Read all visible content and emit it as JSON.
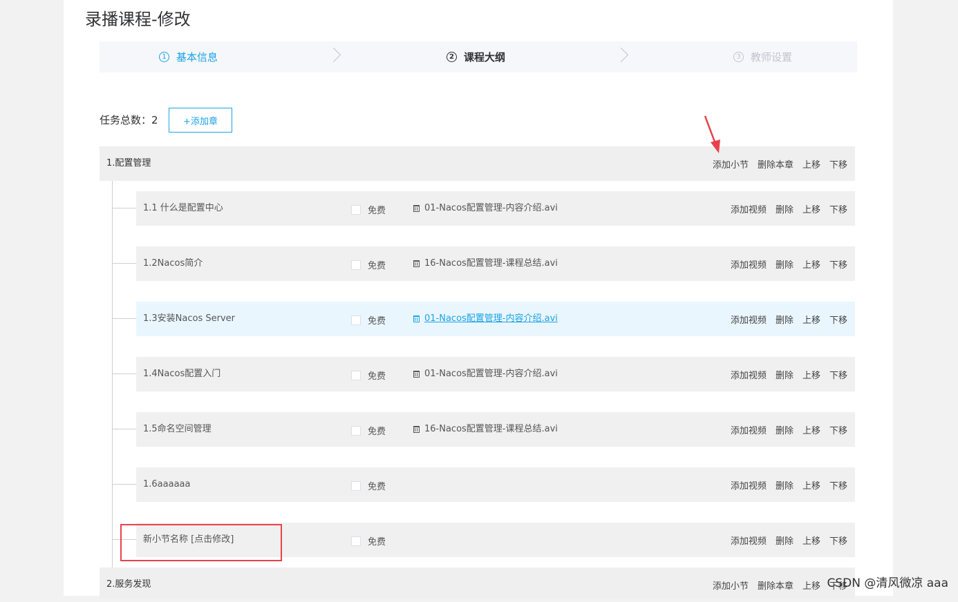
{
  "page": {
    "title": "录播课程-修改"
  },
  "steps": [
    {
      "num": "1",
      "label": "基本信息"
    },
    {
      "num": "2",
      "label": "课程大纲"
    },
    {
      "num": "3",
      "label": "教师设置"
    }
  ],
  "toolbar": {
    "task_total_label": "任务总数：2",
    "add_chapter": "+添加章"
  },
  "chapter_actions": {
    "add_section": "添加小节",
    "delete_chapter": "删除本章",
    "move_up": "上移",
    "move_down": "下移"
  },
  "lesson_actions": {
    "add_video": "添加视频",
    "delete": "删除",
    "move_up": "上移",
    "move_down": "下移"
  },
  "free_label": "免费",
  "chapters": [
    {
      "title": "1.配置管理",
      "lessons": [
        {
          "title": "1.1 什么是配置中心",
          "video": "01-Nacos配置管理-内容介绍.avi"
        },
        {
          "title": "1.2Nacos简介",
          "video": "16-Nacos配置管理-课程总结.avi"
        },
        {
          "title": "1.3安装Nacos Server",
          "video": "01-Nacos配置管理-内容介绍.avi"
        },
        {
          "title": "1.4Nacos配置入门",
          "video": "01-Nacos配置管理-内容介绍.avi"
        },
        {
          "title": "1.5命名空间管理",
          "video": "16-Nacos配置管理-课程总结.avi"
        },
        {
          "title": "1.6aaaaaa",
          "video": ""
        },
        {
          "title": "新小节名称 [点击修改]",
          "video": ""
        }
      ]
    },
    {
      "title": "2.服务发现",
      "lessons": []
    }
  ],
  "watermark": "CSDN @清风微凉 aaa",
  "colors": {
    "accent": "#1aa3e8",
    "highlight": "#e8414b",
    "row_bg": "#f0f0f0",
    "active_row_bg": "#eaf6fd"
  }
}
